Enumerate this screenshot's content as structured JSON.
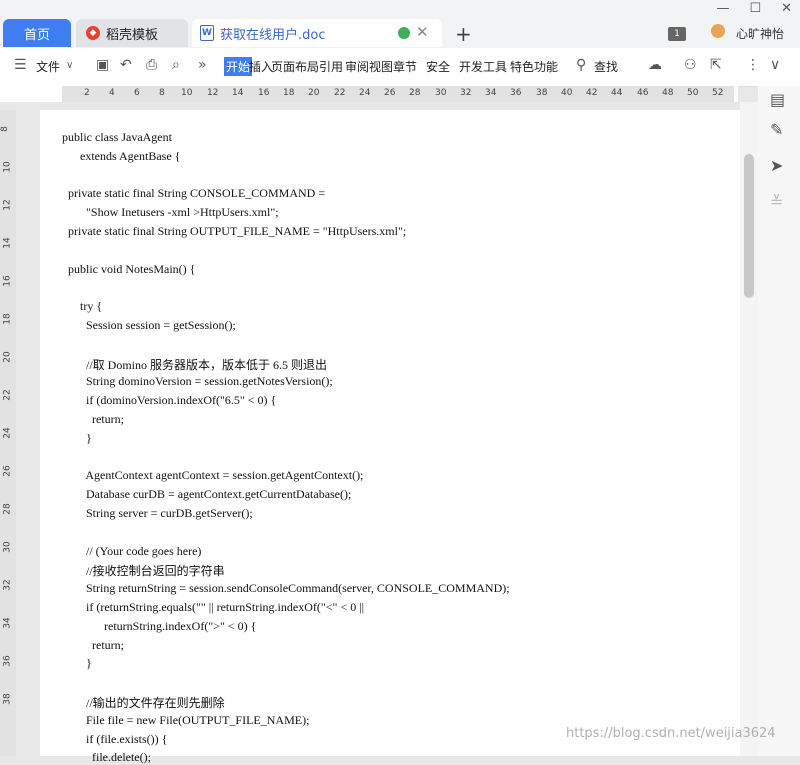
{
  "tabs": [
    {
      "label": "首页"
    },
    {
      "label": "稻壳模板"
    },
    {
      "label": "获取在线用户.doc"
    }
  ],
  "user": {
    "badge": "1",
    "name": "心旷神怡"
  },
  "ribbon": {
    "file": "文件",
    "items": [
      "开始",
      "插入",
      "页面布局",
      "引用",
      "审阅",
      "视图",
      "章节",
      "安全",
      "开发工具",
      "特色功能"
    ],
    "search": "查找"
  },
  "ruler_h": [
    "2",
    "4",
    "6",
    "8",
    "10",
    "12",
    "14",
    "16",
    "18",
    "20",
    "22",
    "24",
    "26",
    "28",
    "30",
    "32",
    "34",
    "36",
    "38",
    "40",
    "42",
    "44",
    "46",
    "48",
    "50",
    "52"
  ],
  "ruler_v": [
    "8",
    "10",
    "12",
    "14",
    "16",
    "18",
    "20",
    "22",
    "24",
    "26",
    "28",
    "30",
    "32",
    "34",
    "36",
    "38"
  ],
  "code": [
    {
      "t": "public class JavaAgent"
    },
    {
      "t": "      extends AgentBase {"
    },
    {
      "t": ""
    },
    {
      "t": "  private static final String CONSOLE_COMMAND ="
    },
    {
      "t": "        \"Show Inetusers -xml >HttpUsers.xml\";"
    },
    {
      "t": "  private static final String OUTPUT_FILE_NAME = \"HttpUsers.xml\";"
    },
    {
      "t": ""
    },
    {
      "t": "  public void NotesMain() {"
    },
    {
      "t": ""
    },
    {
      "t": "      try {"
    },
    {
      "t": "        Session session = getSession();"
    },
    {
      "t": ""
    },
    {
      "t": "        //取 Domino 服务器版本，版本低于 6.5 则退出"
    },
    {
      "t": "        String dominoVersion = session.getNotesVersion();"
    },
    {
      "t": "        if (dominoVersion.indexOf(\"6.5\" < 0) {"
    },
    {
      "t": "          return;"
    },
    {
      "t": "        }"
    },
    {
      "t": ""
    },
    {
      "t": "        AgentContext agentContext = session.getAgentContext();"
    },
    {
      "t": "        Database curDB = agentContext.getCurrentDatabase();"
    },
    {
      "t": "        String server = curDB.getServer();"
    },
    {
      "t": ""
    },
    {
      "t": "        // (Your code goes here)"
    },
    {
      "t": "        //接收控制台返回的字符串"
    },
    {
      "t": "        String returnString = session.sendConsoleCommand(server, CONSOLE_COMMAND);"
    },
    {
      "t": "        if (returnString.equals(\"\" || returnString.indexOf(\"<\" < 0 ||"
    },
    {
      "t": "              returnString.indexOf(\">\" < 0) {"
    },
    {
      "t": "          return;"
    },
    {
      "t": "        }"
    },
    {
      "t": ""
    },
    {
      "t": "        //输出的文件存在则先删除"
    },
    {
      "t": "        File file = new File(OUTPUT_FILE_NAME);"
    },
    {
      "t": "        if (file.exists()) {"
    },
    {
      "t": "          file.delete();"
    }
  ],
  "watermark": "https://blog.csdn.net/weijia3624"
}
